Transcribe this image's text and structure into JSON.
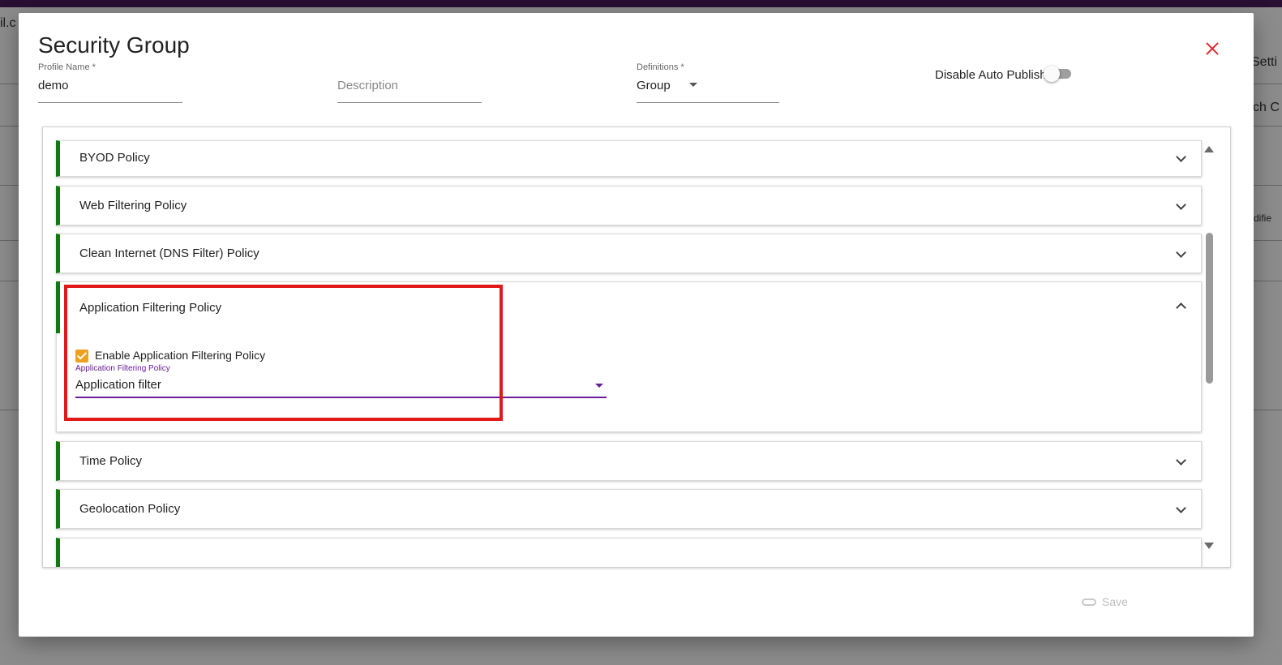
{
  "background": {
    "left_text": "il.c",
    "right_texts": [
      "Setti",
      "ch C",
      "difie"
    ]
  },
  "dialog": {
    "title": "Security Group",
    "close_label": "✕"
  },
  "form": {
    "profile_name": {
      "label": "Profile Name *",
      "value": "demo"
    },
    "description": {
      "placeholder": "Description"
    },
    "definitions": {
      "label": "Definitions *",
      "value": "Group"
    },
    "auto_publish": {
      "label": "Disable Auto Publish:",
      "enabled": false
    }
  },
  "policies": [
    {
      "label": "BYOD Policy",
      "expanded": false
    },
    {
      "label": "Web Filtering Policy",
      "expanded": false
    },
    {
      "label": "Clean Internet (DNS Filter) Policy",
      "expanded": false
    },
    {
      "label": "Application Filtering Policy",
      "expanded": true
    },
    {
      "label": "Time Policy",
      "expanded": false
    },
    {
      "label": "Geolocation Policy",
      "expanded": false
    }
  ],
  "app_filtering": {
    "enable_label": "Enable Application Filtering Policy",
    "enabled": true,
    "select_label": "Application Filtering Policy",
    "select_value": "Application filter"
  },
  "actions": {
    "save_label": "Save"
  },
  "colors": {
    "accent_green": "#0f7a0f",
    "accent_purple": "#6a1b9a",
    "checkbox_orange": "#f0a020",
    "highlight_red": "#e01818",
    "close_red": "#e02b2b",
    "topbar": "#4a1d5e"
  },
  "icons": [
    "close-icon",
    "chevron-down-icon",
    "chevron-up-icon",
    "dropdown-arrow-icon",
    "checkbox-check-icon",
    "save-icon",
    "scroll-up-icon",
    "scroll-down-icon"
  ]
}
